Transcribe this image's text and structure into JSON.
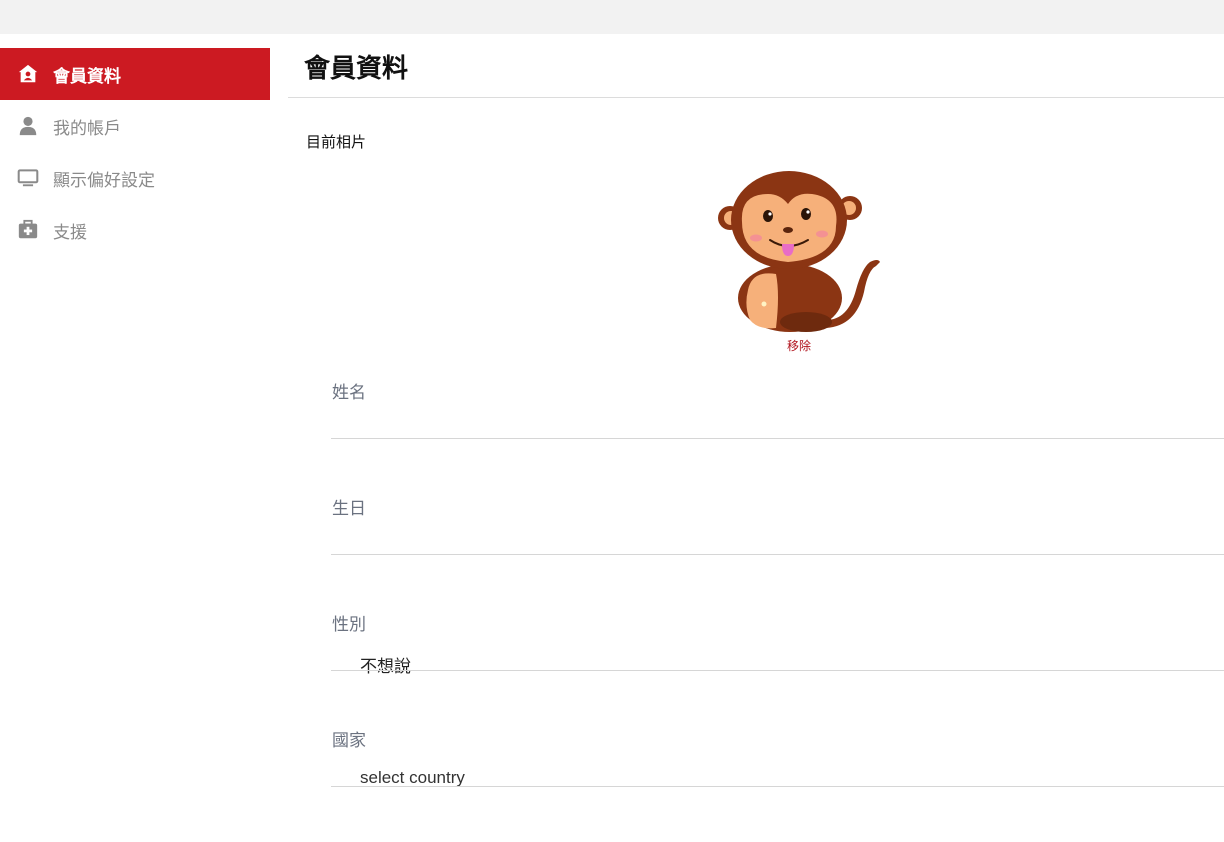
{
  "sidebar": {
    "items": [
      {
        "label": "會員資料",
        "icon": "home-user-icon",
        "active": true
      },
      {
        "label": "我的帳戶",
        "icon": "user-icon",
        "active": false
      },
      {
        "label": "顯示偏好設定",
        "icon": "monitor-icon",
        "active": false
      },
      {
        "label": "支援",
        "icon": "first-aid-kit-icon",
        "active": false
      }
    ]
  },
  "main": {
    "title": "會員資料",
    "photo": {
      "label": "目前相片",
      "remove_label": "移除",
      "avatar_icon": "monkey-avatar"
    },
    "fields": {
      "name": {
        "label": "姓名",
        "value": ""
      },
      "birthday": {
        "label": "生日",
        "value": ""
      },
      "gender": {
        "label": "性別",
        "value": "不想說"
      },
      "country": {
        "label": "國家",
        "value": "select country"
      }
    }
  },
  "colors": {
    "accent": "#cc1a22",
    "topbar": "#f2f2f2",
    "sidebar_text": "#8a8a8a",
    "label_text": "#6b7280",
    "remove_link": "#b0121c"
  }
}
